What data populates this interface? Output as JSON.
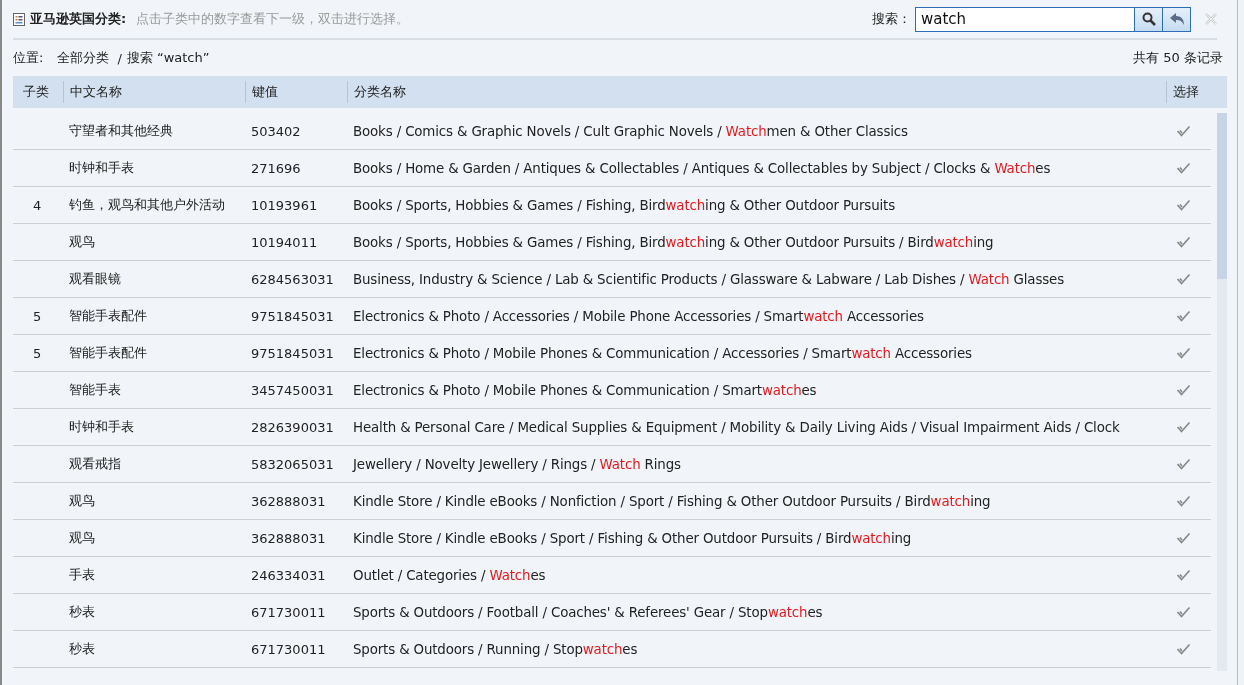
{
  "header": {
    "title": "亚马逊英国分类:",
    "hint": "点击子类中的数字查看下一级，双击进行选择。",
    "search_label": "搜索：",
    "search_value": "watch"
  },
  "location": {
    "label": "位置:",
    "root": "全部分类",
    "separator": "/",
    "current": "搜索 “watch”",
    "count": "共有 50 条记录"
  },
  "table": {
    "columns": [
      "子类",
      "中文名称",
      "键值",
      "分类名称",
      "选择"
    ],
    "rows": [
      {
        "cn": "守望者和其他经典",
        "key": "503402",
        "path": [
          {
            "text": "Books / Comics & Graphic Novels / Cult Graphic Novels / ",
            "hit": false
          },
          {
            "text": "Watch",
            "hit": true
          },
          {
            "text": "men & Other Classics",
            "hit": false
          }
        ]
      },
      {
        "cn": "时钟和手表",
        "key": "271696",
        "path": [
          {
            "text": "Books / Home & Garden / Antiques & Collectables / Antiques & Collectables by Subject / Clocks & ",
            "hit": false
          },
          {
            "text": "Watch",
            "hit": true
          },
          {
            "text": "es",
            "hit": false
          }
        ]
      },
      {
        "sub": "4",
        "cn": "钓鱼，观鸟和其他户外活动",
        "key": "10193961",
        "path": [
          {
            "text": "Books / Sports, Hobbies & Games / Fishing, Bird",
            "hit": false
          },
          {
            "text": "watch",
            "hit": true
          },
          {
            "text": "ing & Other Outdoor Pursuits",
            "hit": false
          }
        ]
      },
      {
        "cn": "观鸟",
        "key": "10194011",
        "path": [
          {
            "text": "Books / Sports, Hobbies & Games / Fishing, Bird",
            "hit": false
          },
          {
            "text": "watch",
            "hit": true
          },
          {
            "text": "ing & Other Outdoor Pursuits / Bird",
            "hit": false
          },
          {
            "text": "watch",
            "hit": true
          },
          {
            "text": "ing",
            "hit": false
          }
        ]
      },
      {
        "cn": "观看眼镜",
        "key": "6284563031",
        "path": [
          {
            "text": "Business, Industry & Science / Lab & Scientific Products / Glassware & Labware / Lab Dishes / ",
            "hit": false
          },
          {
            "text": "Watch",
            "hit": true
          },
          {
            "text": " Glasses",
            "hit": false
          }
        ]
      },
      {
        "sub": "5",
        "cn": "智能手表配件",
        "key": "9751845031",
        "path": [
          {
            "text": "Electronics & Photo / Accessories / Mobile Phone Accessories / Smart",
            "hit": false
          },
          {
            "text": "watch",
            "hit": true
          },
          {
            "text": " Accessories",
            "hit": false
          }
        ]
      },
      {
        "sub": "5",
        "cn": "智能手表配件",
        "key": "9751845031",
        "path": [
          {
            "text": "Electronics & Photo / Mobile Phones & Communication / Accessories / Smart",
            "hit": false
          },
          {
            "text": "watch",
            "hit": true
          },
          {
            "text": " Accessories",
            "hit": false
          }
        ]
      },
      {
        "cn": "智能手表",
        "key": "3457450031",
        "path": [
          {
            "text": "Electronics & Photo / Mobile Phones & Communication / Smart",
            "hit": false
          },
          {
            "text": "watch",
            "hit": true
          },
          {
            "text": "es",
            "hit": false
          }
        ]
      },
      {
        "cn": "时钟和手表",
        "key": "2826390031",
        "path": [
          {
            "text": "Health & Personal Care / Medical Supplies & Equipment / Mobility & Daily Living Aids / Visual Impairment Aids / Clock",
            "hit": false
          }
        ]
      },
      {
        "cn": "观看戒指",
        "key": "5832065031",
        "path": [
          {
            "text": "Jewellery / Novelty Jewellery / Rings / ",
            "hit": false
          },
          {
            "text": "Watch",
            "hit": true
          },
          {
            "text": " Rings",
            "hit": false
          }
        ]
      },
      {
        "cn": "观鸟",
        "key": "362888031",
        "path": [
          {
            "text": "Kindle Store / Kindle eBooks / Nonfiction / Sport / Fishing & Other Outdoor Pursuits / Bird",
            "hit": false
          },
          {
            "text": "watch",
            "hit": true
          },
          {
            "text": "ing",
            "hit": false
          }
        ]
      },
      {
        "cn": "观鸟",
        "key": "362888031",
        "path": [
          {
            "text": "Kindle Store / Kindle eBooks / Sport / Fishing & Other Outdoor Pursuits / Bird",
            "hit": false
          },
          {
            "text": "watch",
            "hit": true
          },
          {
            "text": "ing",
            "hit": false
          }
        ]
      },
      {
        "cn": "手表",
        "key": "246334031",
        "path": [
          {
            "text": "Outlet / Categories / ",
            "hit": false
          },
          {
            "text": "Watch",
            "hit": true
          },
          {
            "text": "es",
            "hit": false
          }
        ]
      },
      {
        "cn": "秒表",
        "key": "671730011",
        "path": [
          {
            "text": "Sports & Outdoors / Football / Coaches' & Referees' Gear / Stop",
            "hit": false
          },
          {
            "text": "watch",
            "hit": true
          },
          {
            "text": "es",
            "hit": false
          }
        ]
      },
      {
        "cn": "秒表",
        "key": "671730011",
        "path": [
          {
            "text": "Sports & Outdoors / Running / Stop",
            "hit": false
          },
          {
            "text": "watch",
            "hit": true
          },
          {
            "text": "es",
            "hit": false
          }
        ]
      }
    ]
  }
}
